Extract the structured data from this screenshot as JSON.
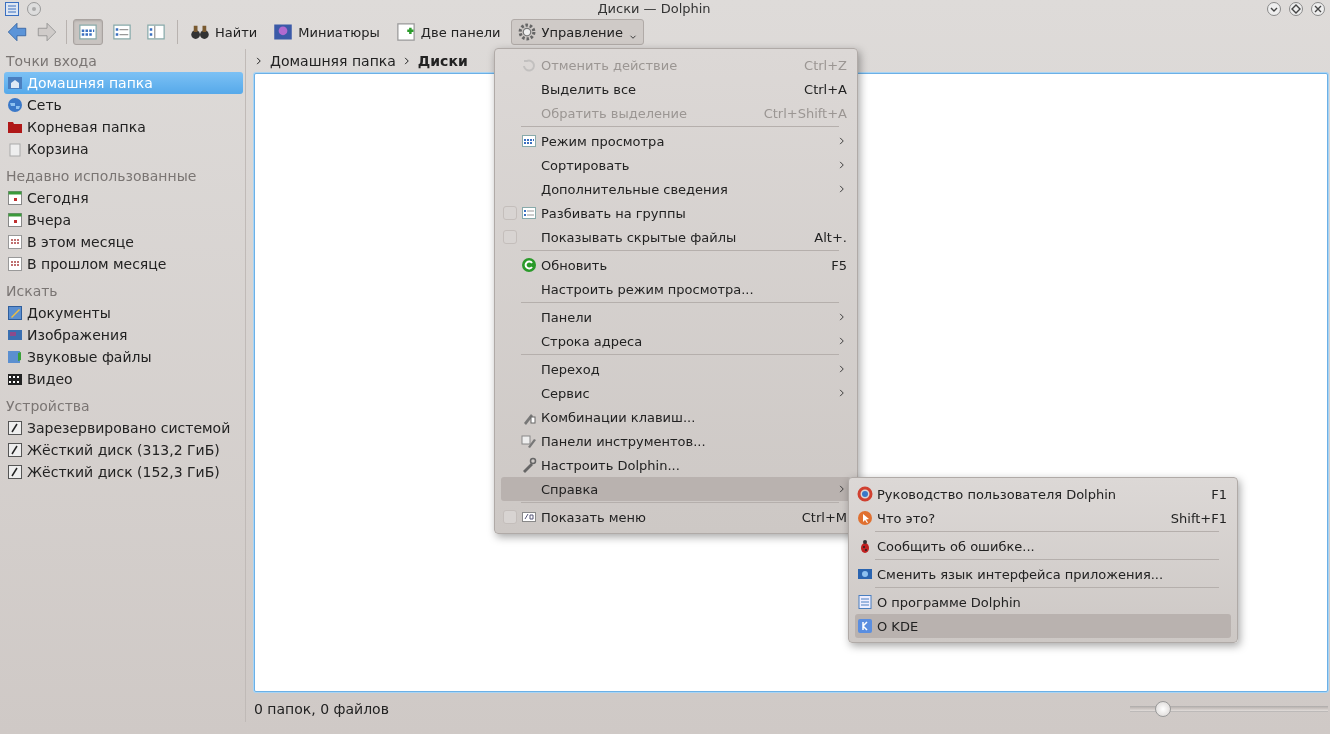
{
  "window": {
    "title": "Диски — Dolphin"
  },
  "toolbar": {
    "back": {
      "disabled": false
    },
    "forward": {
      "disabled": true
    },
    "view_modes": [
      {
        "selected": true
      },
      {
        "selected": false
      },
      {
        "selected": false
      }
    ],
    "buttons": [
      {
        "label": "Найти"
      },
      {
        "label": "Миниатюры"
      },
      {
        "label": "Две панели"
      },
      {
        "label": "Управление",
        "expanded": true
      }
    ]
  },
  "sidebar": {
    "sections": [
      {
        "heading": "Точки входа",
        "items": [
          {
            "label": "Домашняя папка",
            "selected": true
          },
          {
            "label": "Сеть",
            "selected": false
          },
          {
            "label": "Корневая папка",
            "selected": false
          },
          {
            "label": "Корзина",
            "selected": false
          }
        ]
      },
      {
        "heading": "Недавно использованные",
        "items": [
          {
            "label": "Сегодня",
            "selected": false
          },
          {
            "label": "Вчера",
            "selected": false
          },
          {
            "label": "В этом месяце",
            "selected": false
          },
          {
            "label": "В прошлом месяце",
            "selected": false
          }
        ]
      },
      {
        "heading": "Искать",
        "items": [
          {
            "label": "Документы",
            "selected": false
          },
          {
            "label": "Изображения",
            "selected": false
          },
          {
            "label": "Звуковые файлы",
            "selected": false
          },
          {
            "label": "Видео",
            "selected": false
          }
        ]
      },
      {
        "heading": "Устройства",
        "items": [
          {
            "label": "Зарезервировано системой",
            "selected": false
          },
          {
            "label": "Жёсткий диск (313,2 ГиБ)",
            "selected": false
          },
          {
            "label": "Жёсткий диск (152,3 ГиБ)",
            "selected": false
          }
        ]
      }
    ]
  },
  "breadcrumb": [
    {
      "label": "Домашняя папка",
      "current": false
    },
    {
      "label": "Диски",
      "current": true
    }
  ],
  "menu": {
    "items": [
      {
        "kind": "item",
        "label": "Отменить действие",
        "shortcut": "Ctrl+Z",
        "disabled": true,
        "selected": false
      },
      {
        "kind": "item",
        "label": "Выделить все",
        "shortcut": "Ctrl+A",
        "disabled": false,
        "selected": false
      },
      {
        "kind": "item",
        "label": "Обратить выделение",
        "shortcut": "Ctrl+Shift+A",
        "disabled": true,
        "selected": false
      },
      {
        "kind": "separator"
      },
      {
        "kind": "submenu",
        "label": "Режим просмотра",
        "disabled": false,
        "selected": false
      },
      {
        "kind": "submenu",
        "label": "Сортировать",
        "disabled": false,
        "selected": false
      },
      {
        "kind": "submenu",
        "label": "Дополнительные сведения",
        "disabled": false,
        "selected": false
      },
      {
        "kind": "check",
        "label": "Разбивать на группы",
        "checked": false,
        "disabled": false,
        "selected": false
      },
      {
        "kind": "check",
        "label": "Показывать скрытые файлы",
        "shortcut": "Alt+.",
        "checked": false,
        "disabled": false,
        "selected": false
      },
      {
        "kind": "separator"
      },
      {
        "kind": "item",
        "label": "Обновить",
        "shortcut": "F5",
        "disabled": false,
        "selected": false
      },
      {
        "kind": "item",
        "label": "Настроить режим просмотра...",
        "disabled": false,
        "selected": false
      },
      {
        "kind": "separator"
      },
      {
        "kind": "submenu",
        "label": "Панели",
        "disabled": false,
        "selected": false
      },
      {
        "kind": "submenu",
        "label": "Строка адреса",
        "disabled": false,
        "selected": false
      },
      {
        "kind": "separator"
      },
      {
        "kind": "submenu",
        "label": "Переход",
        "disabled": false,
        "selected": false
      },
      {
        "kind": "submenu",
        "label": "Сервис",
        "disabled": false,
        "selected": false
      },
      {
        "kind": "item",
        "label": "Комбинации клавиш...",
        "disabled": false,
        "selected": false
      },
      {
        "kind": "item",
        "label": "Панели инструментов...",
        "disabled": false,
        "selected": false
      },
      {
        "kind": "item",
        "label": "Настроить Dolphin...",
        "disabled": false,
        "selected": false
      },
      {
        "kind": "submenu",
        "label": "Справка",
        "disabled": false,
        "selected": true
      },
      {
        "kind": "separator"
      },
      {
        "kind": "check",
        "label": "Показать меню",
        "shortcut": "Ctrl+M",
        "checked": false,
        "disabled": false,
        "selected": false
      }
    ]
  },
  "submenu": {
    "items": [
      {
        "kind": "item",
        "label": "Руководство пользователя Dolphin",
        "shortcut": "F1",
        "disabled": false,
        "selected": false
      },
      {
        "kind": "item",
        "label": "Что это?",
        "shortcut": "Shift+F1",
        "disabled": false,
        "selected": false
      },
      {
        "kind": "separator"
      },
      {
        "kind": "item",
        "label": "Сообщить об ошибке...",
        "disabled": false,
        "selected": false
      },
      {
        "kind": "separator"
      },
      {
        "kind": "item",
        "label": "Сменить язык интерфейса приложения...",
        "disabled": false,
        "selected": false
      },
      {
        "kind": "separator"
      },
      {
        "kind": "item",
        "label": "О программе Dolphin",
        "disabled": false,
        "selected": false
      },
      {
        "kind": "item",
        "label": "О KDE",
        "disabled": false,
        "selected": true
      }
    ]
  },
  "status_bar": {
    "text": "0 папок, 0 файлов",
    "zoom_slider": {
      "level": 0.14
    }
  }
}
